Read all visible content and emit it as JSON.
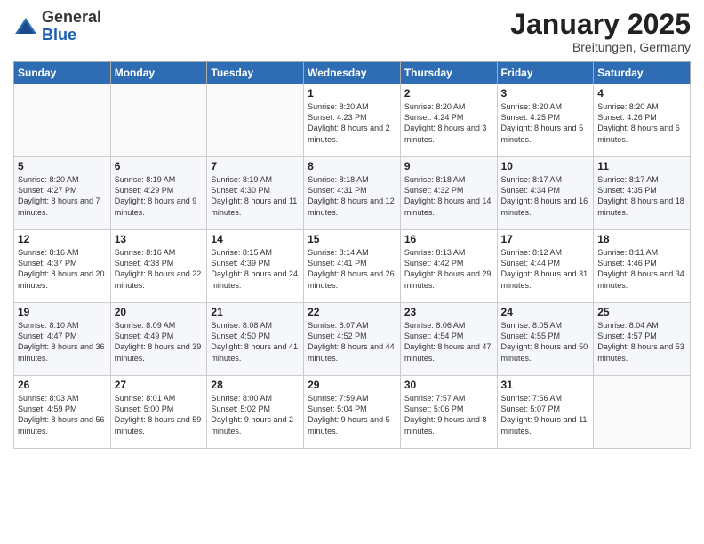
{
  "logo": {
    "general": "General",
    "blue": "Blue"
  },
  "title": "January 2025",
  "location": "Breitungen, Germany",
  "days_of_week": [
    "Sunday",
    "Monday",
    "Tuesday",
    "Wednesday",
    "Thursday",
    "Friday",
    "Saturday"
  ],
  "weeks": [
    [
      {
        "day": "",
        "info": ""
      },
      {
        "day": "",
        "info": ""
      },
      {
        "day": "",
        "info": ""
      },
      {
        "day": "1",
        "info": "Sunrise: 8:20 AM\nSunset: 4:23 PM\nDaylight: 8 hours and 2 minutes."
      },
      {
        "day": "2",
        "info": "Sunrise: 8:20 AM\nSunset: 4:24 PM\nDaylight: 8 hours and 3 minutes."
      },
      {
        "day": "3",
        "info": "Sunrise: 8:20 AM\nSunset: 4:25 PM\nDaylight: 8 hours and 5 minutes."
      },
      {
        "day": "4",
        "info": "Sunrise: 8:20 AM\nSunset: 4:26 PM\nDaylight: 8 hours and 6 minutes."
      }
    ],
    [
      {
        "day": "5",
        "info": "Sunrise: 8:20 AM\nSunset: 4:27 PM\nDaylight: 8 hours and 7 minutes."
      },
      {
        "day": "6",
        "info": "Sunrise: 8:19 AM\nSunset: 4:29 PM\nDaylight: 8 hours and 9 minutes."
      },
      {
        "day": "7",
        "info": "Sunrise: 8:19 AM\nSunset: 4:30 PM\nDaylight: 8 hours and 11 minutes."
      },
      {
        "day": "8",
        "info": "Sunrise: 8:18 AM\nSunset: 4:31 PM\nDaylight: 8 hours and 12 minutes."
      },
      {
        "day": "9",
        "info": "Sunrise: 8:18 AM\nSunset: 4:32 PM\nDaylight: 8 hours and 14 minutes."
      },
      {
        "day": "10",
        "info": "Sunrise: 8:17 AM\nSunset: 4:34 PM\nDaylight: 8 hours and 16 minutes."
      },
      {
        "day": "11",
        "info": "Sunrise: 8:17 AM\nSunset: 4:35 PM\nDaylight: 8 hours and 18 minutes."
      }
    ],
    [
      {
        "day": "12",
        "info": "Sunrise: 8:16 AM\nSunset: 4:37 PM\nDaylight: 8 hours and 20 minutes."
      },
      {
        "day": "13",
        "info": "Sunrise: 8:16 AM\nSunset: 4:38 PM\nDaylight: 8 hours and 22 minutes."
      },
      {
        "day": "14",
        "info": "Sunrise: 8:15 AM\nSunset: 4:39 PM\nDaylight: 8 hours and 24 minutes."
      },
      {
        "day": "15",
        "info": "Sunrise: 8:14 AM\nSunset: 4:41 PM\nDaylight: 8 hours and 26 minutes."
      },
      {
        "day": "16",
        "info": "Sunrise: 8:13 AM\nSunset: 4:42 PM\nDaylight: 8 hours and 29 minutes."
      },
      {
        "day": "17",
        "info": "Sunrise: 8:12 AM\nSunset: 4:44 PM\nDaylight: 8 hours and 31 minutes."
      },
      {
        "day": "18",
        "info": "Sunrise: 8:11 AM\nSunset: 4:46 PM\nDaylight: 8 hours and 34 minutes."
      }
    ],
    [
      {
        "day": "19",
        "info": "Sunrise: 8:10 AM\nSunset: 4:47 PM\nDaylight: 8 hours and 36 minutes."
      },
      {
        "day": "20",
        "info": "Sunrise: 8:09 AM\nSunset: 4:49 PM\nDaylight: 8 hours and 39 minutes."
      },
      {
        "day": "21",
        "info": "Sunrise: 8:08 AM\nSunset: 4:50 PM\nDaylight: 8 hours and 41 minutes."
      },
      {
        "day": "22",
        "info": "Sunrise: 8:07 AM\nSunset: 4:52 PM\nDaylight: 8 hours and 44 minutes."
      },
      {
        "day": "23",
        "info": "Sunrise: 8:06 AM\nSunset: 4:54 PM\nDaylight: 8 hours and 47 minutes."
      },
      {
        "day": "24",
        "info": "Sunrise: 8:05 AM\nSunset: 4:55 PM\nDaylight: 8 hours and 50 minutes."
      },
      {
        "day": "25",
        "info": "Sunrise: 8:04 AM\nSunset: 4:57 PM\nDaylight: 8 hours and 53 minutes."
      }
    ],
    [
      {
        "day": "26",
        "info": "Sunrise: 8:03 AM\nSunset: 4:59 PM\nDaylight: 8 hours and 56 minutes."
      },
      {
        "day": "27",
        "info": "Sunrise: 8:01 AM\nSunset: 5:00 PM\nDaylight: 8 hours and 59 minutes."
      },
      {
        "day": "28",
        "info": "Sunrise: 8:00 AM\nSunset: 5:02 PM\nDaylight: 9 hours and 2 minutes."
      },
      {
        "day": "29",
        "info": "Sunrise: 7:59 AM\nSunset: 5:04 PM\nDaylight: 9 hours and 5 minutes."
      },
      {
        "day": "30",
        "info": "Sunrise: 7:57 AM\nSunset: 5:06 PM\nDaylight: 9 hours and 8 minutes."
      },
      {
        "day": "31",
        "info": "Sunrise: 7:56 AM\nSunset: 5:07 PM\nDaylight: 9 hours and 11 minutes."
      },
      {
        "day": "",
        "info": ""
      }
    ]
  ]
}
